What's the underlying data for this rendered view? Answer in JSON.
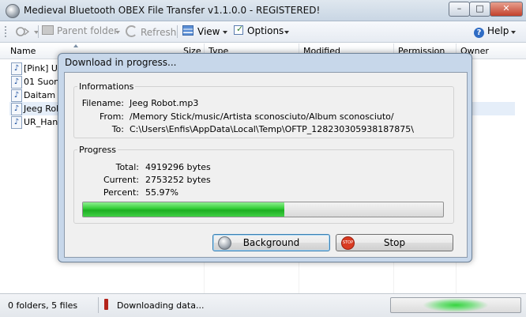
{
  "window": {
    "title": "Medieval Bluetooth OBEX File Transfer v1.1.0.0 - REGISTERED!",
    "minimize": "–",
    "maximize": "□",
    "close": "✕"
  },
  "toolbar": {
    "parent_folder": "Parent folder",
    "refresh": "Refresh",
    "view": "View",
    "options": "Options",
    "help": "Help"
  },
  "columns": {
    "name": "Name",
    "size": "Size",
    "type": "Type",
    "modified": "Modified",
    "permission": "Permission",
    "owner": "Owner"
  },
  "files": [
    {
      "name": "[Pink] U"
    },
    {
      "name": "01 Suone"
    },
    {
      "name": "Daitam II"
    },
    {
      "name": "Jeeg Rob"
    },
    {
      "name": "UR_Han"
    }
  ],
  "status": {
    "folders_files": "0 folders, 5 files",
    "activity": "Downloading data..."
  },
  "dialog": {
    "title": "Download in progress...",
    "info_group": "Informations",
    "filename_label": "Filename:",
    "filename_value": "Jeeg Robot.mp3",
    "from_label": "From:",
    "from_value": "/Memory Stick/music/Artista sconosciuto/Album sconosciuto/",
    "to_label": "To:",
    "to_value": "C:\\Users\\Enfis\\AppData\\Local\\Temp\\OFTP_128230305938187875\\",
    "progress_group": "Progress",
    "total_label": "Total:",
    "total_value": "4919296 bytes",
    "current_label": "Current:",
    "current_value": "2753252 bytes",
    "percent_label": "Percent:",
    "percent_value": "55.97%",
    "progress_fraction": 0.5597,
    "background_button": "Background",
    "stop_button": "Stop",
    "stop_icon_text": "STOP"
  },
  "colors": {
    "progress_green": "#2fcc33",
    "dialog_frame": "#c7d7ea",
    "selection": "#e5eef9"
  }
}
